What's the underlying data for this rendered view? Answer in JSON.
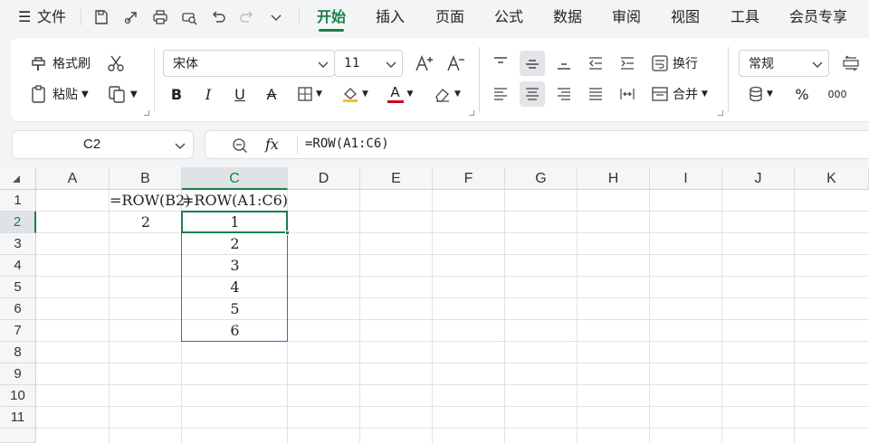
{
  "menubar": {
    "file_label": "文件",
    "tabs": [
      "开始",
      "插入",
      "页面",
      "公式",
      "数据",
      "审阅",
      "视图",
      "工具",
      "会员专享"
    ],
    "active_tab": "开始"
  },
  "ribbon": {
    "format_painter": "格式刷",
    "paste": "粘贴",
    "font_name": "宋体",
    "font_size": "11",
    "wrap_text": "换行",
    "merge": "合并",
    "number_format": "常规",
    "percent": "%",
    "thousands": "000",
    "bold": "B",
    "italic": "I",
    "underline": "U",
    "strike": "A",
    "font_color_letter": "A",
    "colors": {
      "accent": "#1a7f4b",
      "font_color": "#d0021b",
      "fill_color": "#f5c518",
      "selection_border": "#2b6cc4"
    }
  },
  "formula_bar": {
    "name_box": "C2",
    "fx_label": "fx",
    "formula": "=ROW(A1:C6)"
  },
  "sheet": {
    "columns": [
      "A",
      "B",
      "C",
      "D",
      "E",
      "F",
      "G",
      "H",
      "I",
      "J",
      "K"
    ],
    "rows": [
      "1",
      "2",
      "3",
      "4",
      "5",
      "6",
      "7",
      "8",
      "9",
      "10",
      "11"
    ],
    "active_cell": "C2",
    "cells": {
      "B1": "=ROW(B2)",
      "C1": "=ROW(A1:C6)",
      "B2": "2",
      "C2": "1",
      "C3": "2",
      "C4": "3",
      "C5": "4",
      "C6": "5",
      "C7": "6"
    }
  }
}
